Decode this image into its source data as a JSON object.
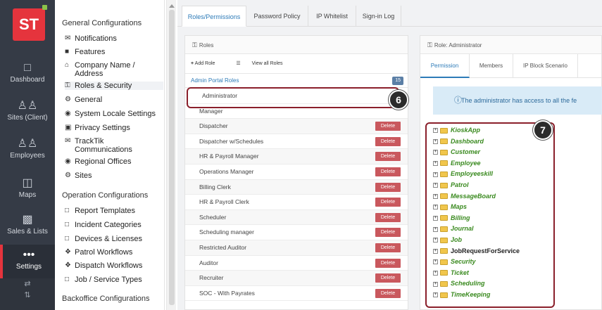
{
  "leftnav": {
    "logo": "ST",
    "items": [
      {
        "label": "Dashboard",
        "icon": "monitor-icon"
      },
      {
        "label": "Sites (Client)",
        "icon": "people-icon"
      },
      {
        "label": "Employees",
        "icon": "people-icon"
      },
      {
        "label": "Maps",
        "icon": "map-icon"
      },
      {
        "label": "Sales & Lists",
        "icon": "bar-chart-icon"
      },
      {
        "label": "Settings",
        "icon": "more-dots-icon"
      }
    ],
    "bottom_icons": [
      "⇄",
      "⇅"
    ]
  },
  "settings_menu": {
    "general_title": "General Configurations",
    "general_items": [
      {
        "label": "Notifications",
        "icon": "envelope-icon"
      },
      {
        "label": "Features",
        "icon": "briefcase-icon"
      },
      {
        "label": "Company Name / Address",
        "icon": "home-icon"
      },
      {
        "label": "Roles & Security",
        "icon": "key-icon"
      },
      {
        "label": "General",
        "icon": "gear-icon"
      },
      {
        "label": "System Locale Settings",
        "icon": "globe-icon"
      },
      {
        "label": "Privacy Settings",
        "icon": "lock-icon"
      },
      {
        "label": "TrackTik Communications",
        "icon": "envelope-icon"
      },
      {
        "label": "Regional Offices",
        "icon": "globe-icon"
      },
      {
        "label": "Sites",
        "icon": "gear-icon"
      }
    ],
    "operation_title": "Operation Configurations",
    "operation_items": [
      {
        "label": "Report Templates",
        "icon": "file-icon"
      },
      {
        "label": "Incident Categories",
        "icon": "file-icon"
      },
      {
        "label": "Devices & Licenses",
        "icon": "file-icon"
      },
      {
        "label": "Patrol Workflows",
        "icon": "workflow-icon"
      },
      {
        "label": "Dispatch Workflows",
        "icon": "workflow-icon"
      },
      {
        "label": "Job / Service Types",
        "icon": "file-icon"
      }
    ],
    "backoffice_title": "Backoffice Configurations"
  },
  "top_tabs": [
    "Roles/Permissions",
    "Password Policy",
    "IP Whitelist",
    "Sign-in Log"
  ],
  "roles_panel": {
    "title": "Roles",
    "add_role": "Add Role",
    "view_all": "View all Roles",
    "group_label": "Admin Portal Roles",
    "count": "15",
    "delete_label": "Delete",
    "roles": [
      "Administrator",
      "Manager",
      "Dispatcher",
      "Dispatcher w/Schedules",
      "HR & Payroll Manager",
      "Operations Manager",
      "Billing Clerk",
      "HR & Payroll Clerk",
      "Scheduler",
      "Scheduling manager",
      "Restricted Auditor",
      "Auditor",
      "Recruiter",
      "SOC - With Payrates"
    ]
  },
  "role_panel": {
    "title": "Role: Administrator",
    "tabs": [
      "Permission",
      "Members",
      "IP Block Scenario"
    ],
    "info": "The administrator has access to all the fe",
    "tree": [
      {
        "label": "KioskApp",
        "style": "green"
      },
      {
        "label": "Dashboard",
        "style": "green"
      },
      {
        "label": "Customer",
        "style": "green"
      },
      {
        "label": "Employee",
        "style": "green"
      },
      {
        "label": "Employeeskill",
        "style": "green"
      },
      {
        "label": "Patrol",
        "style": "green"
      },
      {
        "label": "MessageBoard",
        "style": "green"
      },
      {
        "label": "Maps",
        "style": "green"
      },
      {
        "label": "Billing",
        "style": "green"
      },
      {
        "label": "Journal",
        "style": "green"
      },
      {
        "label": "Job",
        "style": "green"
      },
      {
        "label": "JobRequestForService",
        "style": "plain"
      },
      {
        "label": "Security",
        "style": "green"
      },
      {
        "label": "Ticket",
        "style": "green"
      },
      {
        "label": "Scheduling",
        "style": "green"
      },
      {
        "label": "TimeKeeping",
        "style": "green"
      }
    ]
  },
  "callouts": [
    "6",
    "7"
  ]
}
